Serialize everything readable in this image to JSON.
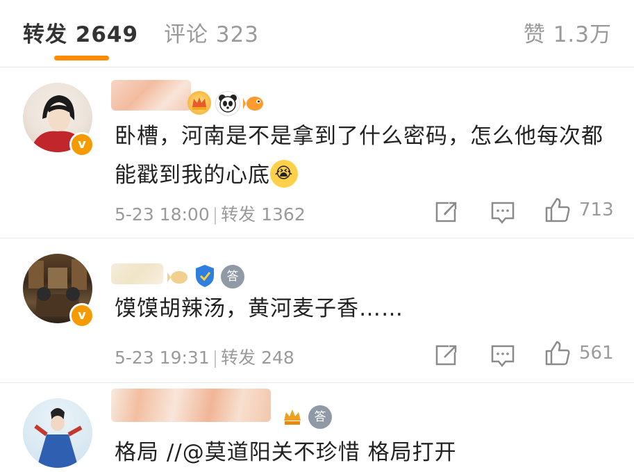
{
  "tabs": {
    "repost": "转发 2649",
    "comments": "评论 323",
    "likes": "赞 1.3万"
  },
  "comments": [
    {
      "text": "卧槽，河南是不是拿到了什么密码，怎么他每次都能戳到我的心底",
      "emoji": "😭",
      "time": "5-23 18:00",
      "repost": "转发 1362",
      "likes": "713"
    },
    {
      "text": "馍馍胡辣汤，黄河麦子香……",
      "time": "5-23 19:31",
      "repost": "转发 248",
      "likes": "561"
    },
    {
      "text_partial": "格局 //@莫道阳关不珍惜 格局打开"
    }
  ],
  "colors": {
    "accent": "#ff8c00",
    "vip": "#f59b00",
    "muted": "#9a9a9a"
  },
  "icons": [
    "share-icon",
    "comment-icon",
    "like-icon",
    "verified-badge-icon",
    "crown-icon",
    "panda-icon",
    "fish-icon",
    "shield-icon",
    "answer-badge-icon",
    "cry-emoji-icon"
  ]
}
